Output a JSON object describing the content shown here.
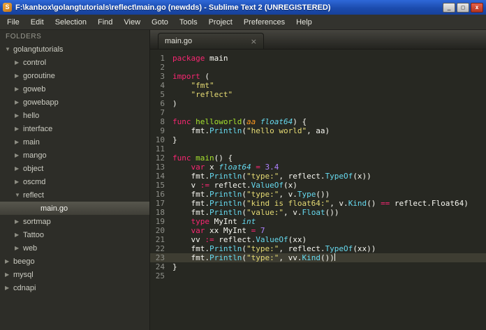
{
  "window": {
    "title": "F:\\kanbox\\golangtutorials\\reflect\\main.go (newdds) - Sublime Text 2 (UNREGISTERED)",
    "app_icon_letter": "S",
    "controls": {
      "minimize": "_",
      "maximize": "□",
      "close": "x"
    }
  },
  "menu": {
    "items": [
      "File",
      "Edit",
      "Selection",
      "Find",
      "View",
      "Goto",
      "Tools",
      "Project",
      "Preferences",
      "Help"
    ]
  },
  "sidebar": {
    "header": "FOLDERS",
    "items": [
      {
        "label": "golangtutorials",
        "level": 0,
        "expand": "open",
        "selected": false
      },
      {
        "label": "control",
        "level": 1,
        "expand": "closed",
        "selected": false
      },
      {
        "label": "goroutine",
        "level": 1,
        "expand": "closed",
        "selected": false
      },
      {
        "label": "goweb",
        "level": 1,
        "expand": "closed",
        "selected": false
      },
      {
        "label": "gowebapp",
        "level": 1,
        "expand": "closed",
        "selected": false
      },
      {
        "label": "hello",
        "level": 1,
        "expand": "closed",
        "selected": false
      },
      {
        "label": "interface",
        "level": 1,
        "expand": "closed",
        "selected": false
      },
      {
        "label": "main",
        "level": 1,
        "expand": "closed",
        "selected": false
      },
      {
        "label": "mango",
        "level": 1,
        "expand": "closed",
        "selected": false
      },
      {
        "label": "object",
        "level": 1,
        "expand": "closed",
        "selected": false
      },
      {
        "label": "oscmd",
        "level": 1,
        "expand": "closed",
        "selected": false
      },
      {
        "label": "reflect",
        "level": 1,
        "expand": "open",
        "selected": false
      },
      {
        "label": "main.go",
        "level": 2,
        "expand": null,
        "selected": true
      },
      {
        "label": "sortmap",
        "level": 1,
        "expand": "closed",
        "selected": false
      },
      {
        "label": "Tattoo",
        "level": 1,
        "expand": "closed",
        "selected": false
      },
      {
        "label": "web",
        "level": 1,
        "expand": "closed",
        "selected": false
      },
      {
        "label": "beego",
        "level": 0,
        "expand": "closed",
        "selected": false
      },
      {
        "label": "mysql",
        "level": 0,
        "expand": "closed",
        "selected": false
      },
      {
        "label": "cdnapi",
        "level": 0,
        "expand": "closed",
        "selected": false
      }
    ]
  },
  "editor": {
    "tab": {
      "label": "main.go",
      "close": "×"
    },
    "active_line": 23,
    "lines": [
      [
        [
          "k",
          "package"
        ],
        [
          "w",
          " main"
        ]
      ],
      [],
      [
        [
          "k",
          "import"
        ],
        [
          "w",
          " ("
        ]
      ],
      [
        [
          "w",
          "    "
        ],
        [
          "s",
          "\"fmt\""
        ]
      ],
      [
        [
          "w",
          "    "
        ],
        [
          "s",
          "\"reflect\""
        ]
      ],
      [
        [
          "w",
          ")"
        ]
      ],
      [],
      [
        [
          "k",
          "func"
        ],
        [
          "w",
          " "
        ],
        [
          "fn",
          "helloworld"
        ],
        [
          "w",
          "("
        ],
        [
          "p",
          "aa"
        ],
        [
          "w",
          " "
        ],
        [
          "t",
          "float64"
        ],
        [
          "w",
          ") {"
        ]
      ],
      [
        [
          "w",
          "    fmt."
        ],
        [
          "c",
          "Println"
        ],
        [
          "w",
          "("
        ],
        [
          "s",
          "\"hello world\""
        ],
        [
          "w",
          ", aa)"
        ]
      ],
      [
        [
          "w",
          "}"
        ]
      ],
      [],
      [
        [
          "k",
          "func"
        ],
        [
          "w",
          " "
        ],
        [
          "fn",
          "main"
        ],
        [
          "w",
          "() {"
        ]
      ],
      [
        [
          "w",
          "    "
        ],
        [
          "k",
          "var"
        ],
        [
          "w",
          " x "
        ],
        [
          "t",
          "float64"
        ],
        [
          "w",
          " "
        ],
        [
          "o",
          "="
        ],
        [
          "w",
          " "
        ],
        [
          "n",
          "3.4"
        ]
      ],
      [
        [
          "w",
          "    fmt."
        ],
        [
          "c",
          "Println"
        ],
        [
          "w",
          "("
        ],
        [
          "s",
          "\"type:\""
        ],
        [
          "w",
          ", reflect."
        ],
        [
          "c",
          "TypeOf"
        ],
        [
          "w",
          "(x))"
        ]
      ],
      [
        [
          "w",
          "    v "
        ],
        [
          "o",
          ":="
        ],
        [
          "w",
          " reflect."
        ],
        [
          "c",
          "ValueOf"
        ],
        [
          "w",
          "(x)"
        ]
      ],
      [
        [
          "w",
          "    fmt."
        ],
        [
          "c",
          "Println"
        ],
        [
          "w",
          "("
        ],
        [
          "s",
          "\"type:\""
        ],
        [
          "w",
          ", v."
        ],
        [
          "c",
          "Type"
        ],
        [
          "w",
          "())"
        ]
      ],
      [
        [
          "w",
          "    fmt."
        ],
        [
          "c",
          "Println"
        ],
        [
          "w",
          "("
        ],
        [
          "s",
          "\"kind is float64:\""
        ],
        [
          "w",
          ", v."
        ],
        [
          "c",
          "Kind"
        ],
        [
          "w",
          "() "
        ],
        [
          "o",
          "=="
        ],
        [
          "w",
          " reflect.Float64)"
        ]
      ],
      [
        [
          "w",
          "    fmt."
        ],
        [
          "c",
          "Println"
        ],
        [
          "w",
          "("
        ],
        [
          "s",
          "\"value:\""
        ],
        [
          "w",
          ", v."
        ],
        [
          "c",
          "Float"
        ],
        [
          "w",
          "())"
        ]
      ],
      [
        [
          "w",
          "    "
        ],
        [
          "k",
          "type"
        ],
        [
          "w",
          " MyInt "
        ],
        [
          "t",
          "int"
        ]
      ],
      [
        [
          "w",
          "    "
        ],
        [
          "k",
          "var"
        ],
        [
          "w",
          " xx MyInt "
        ],
        [
          "o",
          "="
        ],
        [
          "w",
          " "
        ],
        [
          "n",
          "7"
        ]
      ],
      [
        [
          "w",
          "    vv "
        ],
        [
          "o",
          ":="
        ],
        [
          "w",
          " reflect."
        ],
        [
          "c",
          "ValueOf"
        ],
        [
          "w",
          "(xx)"
        ]
      ],
      [
        [
          "w",
          "    fmt."
        ],
        [
          "c",
          "Println"
        ],
        [
          "w",
          "("
        ],
        [
          "s",
          "\"type:\""
        ],
        [
          "w",
          ", reflect."
        ],
        [
          "c",
          "TypeOf"
        ],
        [
          "w",
          "(xx))"
        ]
      ],
      [
        [
          "w",
          "    fmt."
        ],
        [
          "c",
          "Println"
        ],
        [
          "w",
          "("
        ],
        [
          "s",
          "\"type:\""
        ],
        [
          "w",
          ", vv."
        ],
        [
          "c",
          "Kind"
        ],
        [
          "w",
          "())"
        ]
      ],
      [
        [
          "w",
          "}"
        ]
      ],
      []
    ]
  }
}
